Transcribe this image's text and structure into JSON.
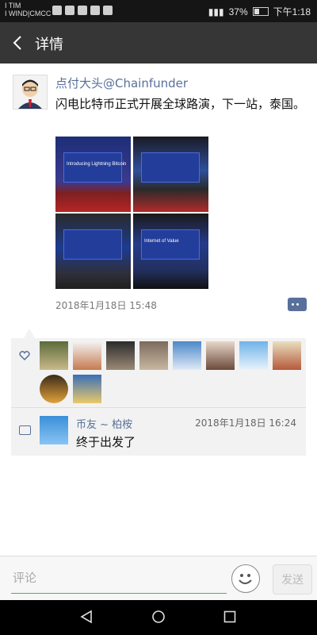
{
  "status_bar": {
    "carrier_line1": "I TIM",
    "carrier_line2": "I WIND|CMCC",
    "battery": "37%",
    "time": "下午1:18",
    "battery_level": 0.37
  },
  "nav": {
    "title": "详情",
    "back_icon": "back-arrow-icon"
  },
  "post": {
    "author": "点付大头@Chainfunder",
    "text": "闪电比特币正式开展全球路演，下一站，泰国。",
    "timestamp": "2018年1月18日 15:48",
    "photos": [
      {
        "caption": "Introducing Lightning Bitcoin"
      },
      {
        "caption": ""
      },
      {
        "caption": ""
      },
      {
        "caption": "Internet of Value"
      }
    ]
  },
  "likes": {
    "icon": "heart-icon",
    "avatars": [
      {
        "color1": "#5b6b3a",
        "color2": "#c9b98a"
      },
      {
        "color1": "#f4f4f4",
        "color2": "#c67a4f"
      },
      {
        "color1": "#2b2b2b",
        "color2": "#9b8a77"
      },
      {
        "color1": "#7c6a5c",
        "color2": "#c8b8a0"
      },
      {
        "color1": "#4c88c9",
        "color2": "#dfeaf6"
      },
      {
        "color1": "#e7d7c9",
        "color2": "#6b4a3a"
      },
      {
        "color1": "#6fb3e8",
        "color2": "#e8f3fb"
      },
      {
        "color1": "#e9dfc0",
        "color2": "#b55a3a"
      },
      {
        "color1": "#3a2a1a",
        "color2": "#e2a23a"
      },
      {
        "color1": "#3a6fb8",
        "color2": "#e9c96a"
      }
    ]
  },
  "comment": {
    "name": "币友 ~ 柏桉",
    "time": "2018年1月18日 16:24",
    "text": "终于出发了"
  },
  "input": {
    "placeholder": "评论",
    "send_label": "发送"
  },
  "colors": {
    "nav_bg": "#363636",
    "link": "#58709a",
    "input_underline": "#46b25b"
  }
}
